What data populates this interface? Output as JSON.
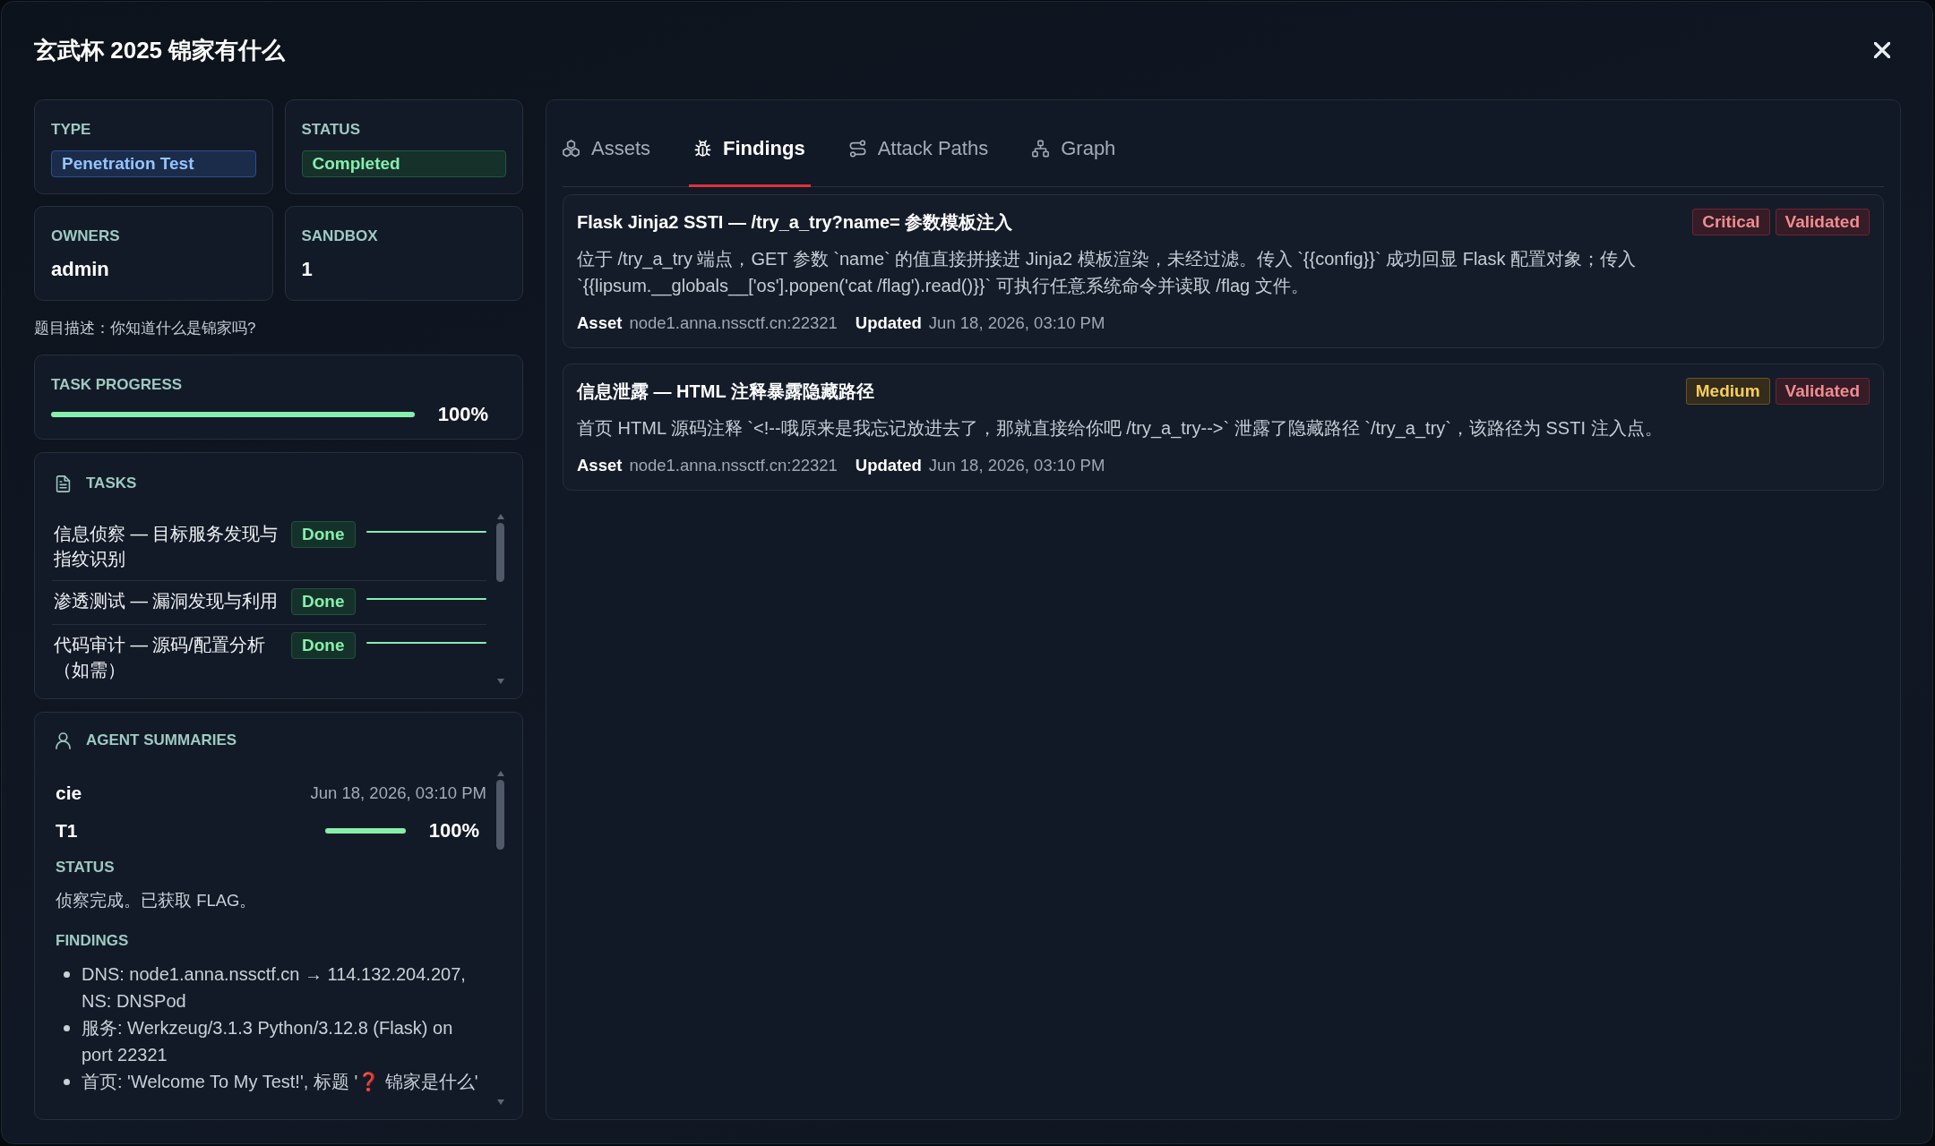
{
  "dialog": {
    "title": "玄武杯 2025 锦家有什么"
  },
  "overview": [
    {
      "label": "TYPE",
      "value": "Penetration Test",
      "kind": "info"
    },
    {
      "label": "STATUS",
      "value": "Completed",
      "kind": "success"
    },
    {
      "label": "OWNERS",
      "value": "admin",
      "kind": "text"
    },
    {
      "label": "SANDBOX",
      "value": "1",
      "kind": "text"
    }
  ],
  "description": "题目描述：你知道什么是锦家吗?",
  "task_progress": {
    "label": "TASK PROGRESS",
    "level": 1,
    "reading": "100%"
  },
  "tasks": {
    "title": "TASKS",
    "items": [
      {
        "name": "信息侦察 — 目标服务发现与指纹识别",
        "status": "Done",
        "level": 1
      },
      {
        "name": "渗透测试 — 漏洞发现与利用",
        "status": "Done",
        "level": 1
      },
      {
        "name": "代码审计 — 源码/配置分析（如需）",
        "status": "Done",
        "level": 1
      }
    ]
  },
  "agent_summaries": {
    "title": "AGENT SUMMARIES",
    "entries": [
      {
        "agent": "cie",
        "time": "Jun 18, 2026, 03:10 PM",
        "task": "T1",
        "level": 1,
        "reading": "100%",
        "status_label": "STATUS",
        "status": "侦察完成。已获取 FLAG。",
        "findings_label": "FINDINGS",
        "findings": [
          "DNS: node1.anna.nssctf.cn → 114.132.204.207, NS: DNSPod",
          "服务: Werkzeug/3.1.3 Python/3.12.8 (Flask) on port 22321",
          "首页: 'Welcome To My Test!', 标题 '❓ 锦家是什么'"
        ]
      }
    ]
  },
  "tabs": [
    {
      "label": "Assets",
      "selected": false
    },
    {
      "label": "Findings",
      "selected": true
    },
    {
      "label": "Attack Paths",
      "selected": false
    },
    {
      "label": "Graph",
      "selected": false
    }
  ],
  "findings": [
    {
      "title": "Flask Jinja2 SSTI — /try_a_try?name= 参数模板注入",
      "badges": [
        {
          "label": "Critical",
          "kind": "critical"
        },
        {
          "label": "Validated",
          "kind": "validated"
        }
      ],
      "description": "位于 /try_a_try 端点，GET 参数 `name` 的值直接拼接进 Jinja2 模板渲染，未经过滤。传入 `{{config}}` 成功回显 Flask 配置对象；传入 `{{lipsum.__globals__['os'].popen('cat /flag').read()}}` 可执行任意系统命令并读取 /flag 文件。",
      "asset_label": "Asset",
      "asset": "node1.anna.nssctf.cn:22321",
      "updated_label": "Updated",
      "updated": "Jun 18, 2026, 03:10 PM"
    },
    {
      "title": "信息泄露 — HTML 注释暴露隐藏路径",
      "badges": [
        {
          "label": "Medium",
          "kind": "medium"
        },
        {
          "label": "Validated",
          "kind": "validated"
        }
      ],
      "description": "首页 HTML 源码注释 `<!--哦原来是我忘记放进去了，那就直接给你吧 /try_a_try-->` 泄露了隐藏路径 `/try_a_try`，该路径为 SSTI 注入点。",
      "asset_label": "Asset",
      "asset": "node1.anna.nssctf.cn:22321",
      "updated_label": "Updated",
      "updated": "Jun 18, 2026, 03:10 PM"
    }
  ]
}
